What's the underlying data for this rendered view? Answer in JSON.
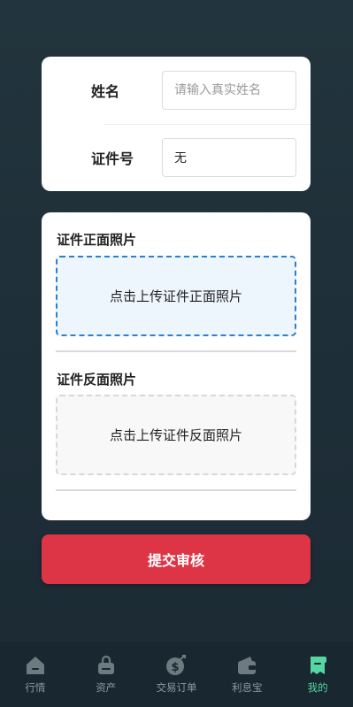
{
  "form": {
    "name_label": "姓名",
    "name_placeholder": "请输入真实姓名",
    "name_value": "",
    "id_label": "证件号",
    "id_value": "无"
  },
  "upload": {
    "front_title": "证件正面照片",
    "front_prompt": "点击上传证件正面照片",
    "back_title": "证件反面照片",
    "back_prompt": "点击上传证件反面照片"
  },
  "submit_label": "提交审核",
  "tabbar": {
    "items": [
      {
        "label": "行情",
        "icon": "home-icon",
        "active": false
      },
      {
        "label": "资产",
        "icon": "bag-icon",
        "active": false
      },
      {
        "label": "交易订单",
        "icon": "coin-icon",
        "active": false
      },
      {
        "label": "利息宝",
        "icon": "wallet-icon",
        "active": false
      },
      {
        "label": "我的",
        "icon": "receipt-icon",
        "active": true
      }
    ],
    "active_color": "#57d6a2",
    "inactive_color": "#8d9aa1"
  }
}
